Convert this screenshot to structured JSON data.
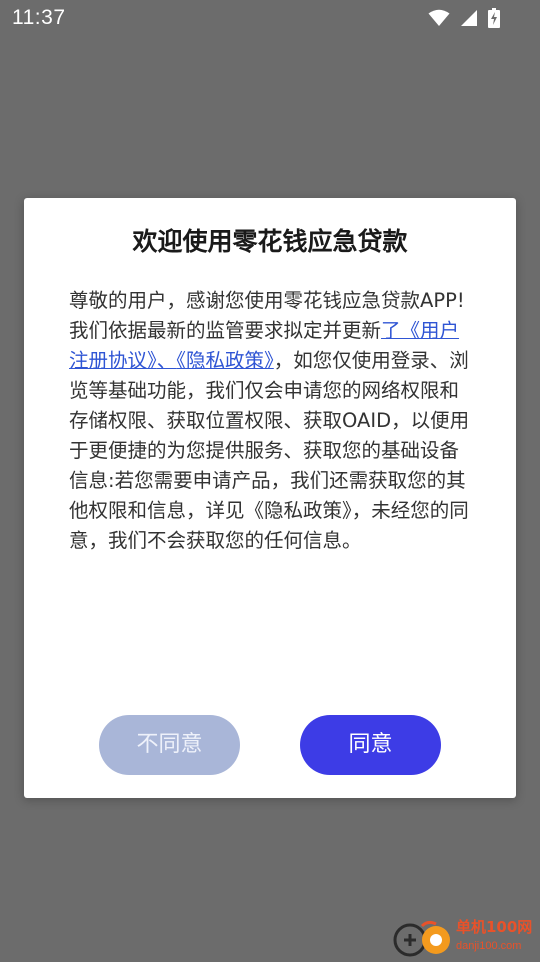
{
  "status_bar": {
    "time": "11:37",
    "icons": [
      "wifi-icon",
      "cellular-signal-icon",
      "battery-charging-icon"
    ]
  },
  "dialog": {
    "title": "欢迎使用零花钱应急贷款",
    "body": {
      "line1": "尊敬的用户，感谢您使用零花钱应急贷款APP!",
      "p2_before_link": "我们依据最新的监管要求拟定并更新",
      "link_user_agreement": "了《用户注册协议》",
      "separator": "、",
      "link_privacy_policy": "《隐私政策》",
      "p2_after_link": "，如您仅使用登录、浏览等基础功能，我们仅会申请您的网络权限和存储权限、获取位置权限、获取OAID，以便用于更便捷的为您提供服务、获取您的基础设备信息:若您需要申请产品，我们还需获取您的其他权限和信息，详见《隐私政策》，未经您的同意，我们不会获取您的任何信息。"
    },
    "disagree_label": "不同意",
    "agree_label": "同意"
  },
  "watermark": {
    "name": "单机100网",
    "url": "danji100.com"
  },
  "colors": {
    "backdrop": "#6c6c6c",
    "link": "#2f55d4",
    "agree_button": "#3d3ce6",
    "disagree_button": "#a9b6d8",
    "watermark": "#e8522a"
  }
}
